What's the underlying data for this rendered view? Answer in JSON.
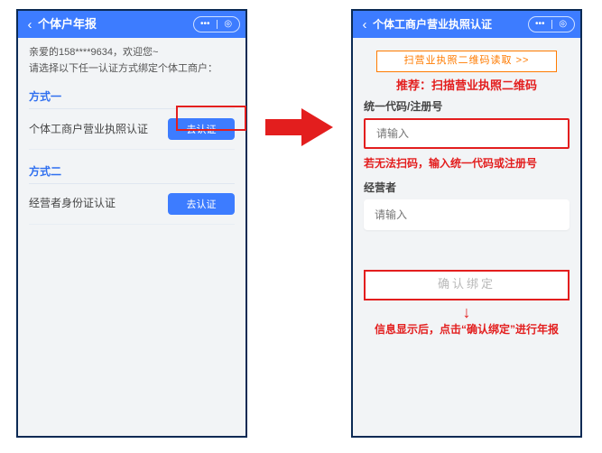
{
  "left_phone": {
    "title": "个体户年报",
    "greeting_l1": "亲爱的158****9634，欢迎您~",
    "greeting_l2": "请选择以下任一认证方式绑定个体工商户：",
    "method1_title": "方式一",
    "method1_text": "个体工商户营业执照认证",
    "method1_btn": "去认证",
    "method2_title": "方式二",
    "method2_text": "经营者身份证认证",
    "method2_btn": "去认证"
  },
  "right_phone": {
    "title": "个体工商户营业执照认证",
    "scan_label": "扫营业执照二维码读取 >>",
    "recommend": "推荐：扫描营业执照二维码",
    "code_label": "统一代码/注册号",
    "code_placeholder": "请输入",
    "code_tip": "若无法扫码，输入统一代码或注册号",
    "operator_label": "经营者",
    "operator_placeholder": "请输入",
    "confirm_label": "确认绑定",
    "final_tip": "信息显示后，点击“确认绑定”进行年报"
  },
  "icons": {
    "back": "‹",
    "dots": "•••",
    "target": "◎",
    "arrow_down": "↓"
  }
}
